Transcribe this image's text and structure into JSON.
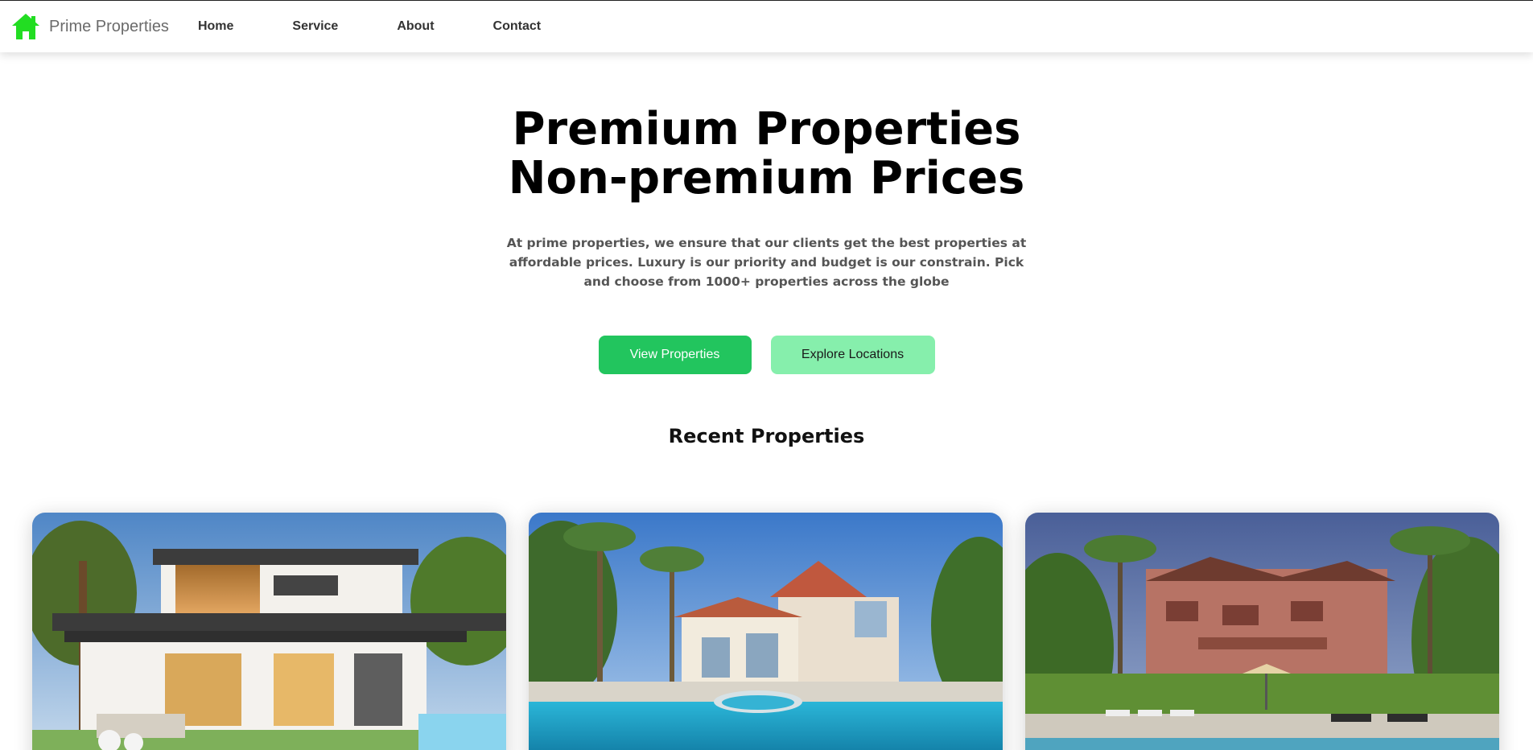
{
  "nav": {
    "brand": "Prime Properties",
    "brand_icon": "house-icon",
    "brand_color": "#22dd22",
    "links": [
      "Home",
      "Service",
      "About",
      "Contact"
    ]
  },
  "hero": {
    "title_line1": "Premium Properties",
    "title_line2": "Non-premium Prices",
    "description": "At prime properties, we ensure that our clients get the best properties at affordable prices. Luxury is our priority and budget is our constrain. Pick and choose from 1000+ properties across the globe",
    "primary_button": "View Properties",
    "secondary_button": "Explore Locations",
    "primary_color": "#22c55e",
    "secondary_color": "#86efac"
  },
  "recent": {
    "title": "Recent Properties",
    "cards": [
      {
        "image": "modern-house-photo"
      },
      {
        "image": "pool-villa-photo"
      },
      {
        "image": "resort-photo"
      }
    ]
  }
}
